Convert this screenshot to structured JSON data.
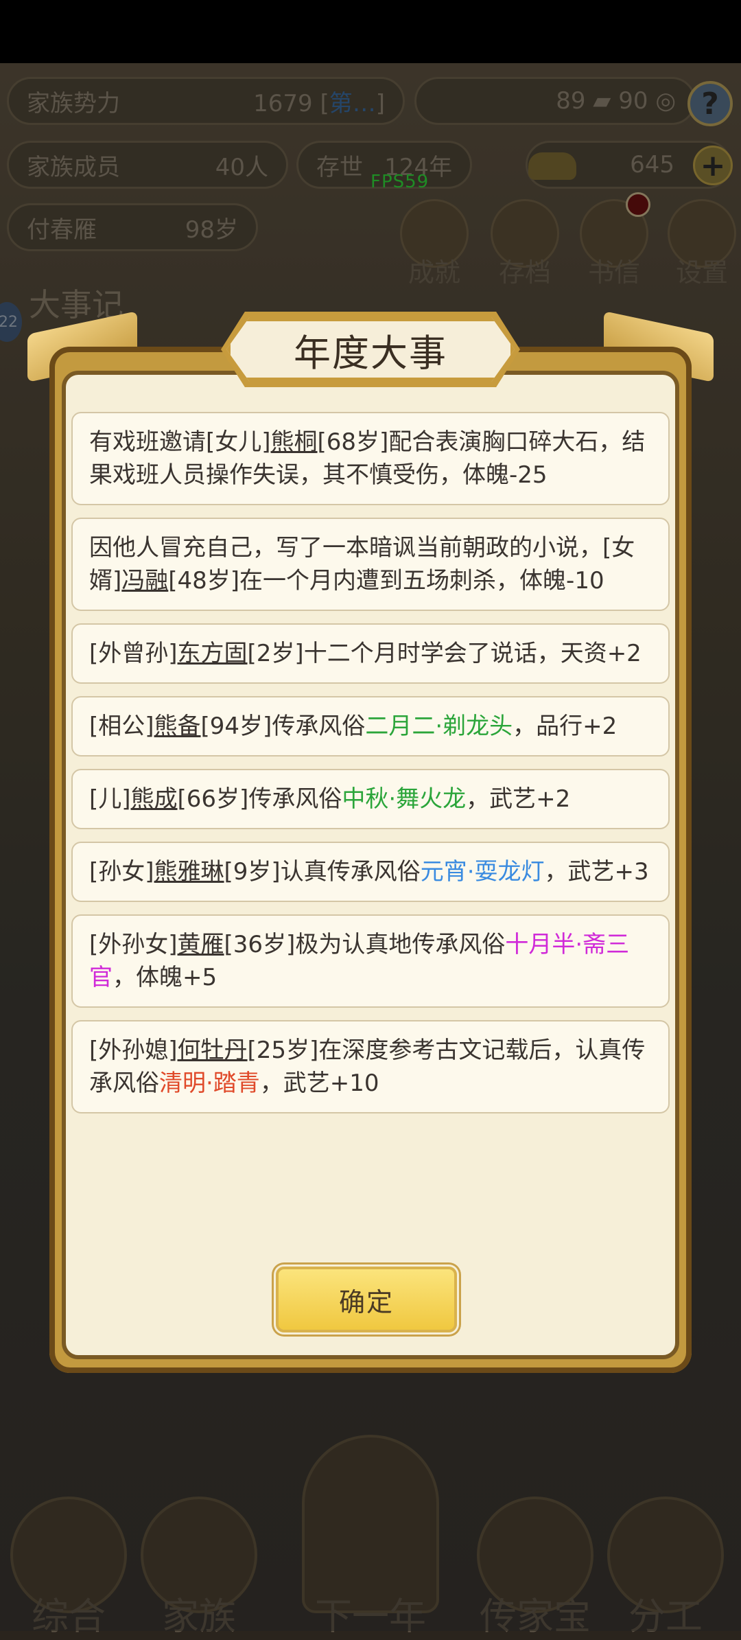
{
  "status_bar": {},
  "header": {
    "family_power_label": "家族势力",
    "family_power_value": "1679 [",
    "family_power_rank": "第…",
    "family_power_close": "]",
    "coins_value": "89",
    "coins_max": "90",
    "members_label": "家族成员",
    "members_value": "40人",
    "existence_label": "存世",
    "existence_value": "124年",
    "gold_value": "645",
    "patriarch_name": "付春雁",
    "patriarch_age": "98岁"
  },
  "fps": "FPS59",
  "top_buttons": [
    {
      "label": "成就",
      "icon": "achievement-icon"
    },
    {
      "label": "存档",
      "icon": "save-icon"
    },
    {
      "label": "书信",
      "icon": "letter-icon"
    },
    {
      "label": "设置",
      "icon": "settings-icon"
    }
  ],
  "background_title": "大事记",
  "day_badge": "22",
  "modal": {
    "title": "年度大事",
    "confirm_label": "确定",
    "events": [
      {
        "parts": [
          {
            "t": "有戏班邀请[女儿]"
          },
          {
            "t": "熊桐",
            "u": true
          },
          {
            "t": "[68岁]配合表演胸口碎大石，结果戏班人员操作失误，其不慎受伤，体魄-25"
          }
        ]
      },
      {
        "parts": [
          {
            "t": "因他人冒充自己，写了一本暗讽当前朝政的小说，[女婿]"
          },
          {
            "t": "冯融",
            "u": true
          },
          {
            "t": "[48岁]在一个月内遭到五场刺杀，体魄-10"
          }
        ]
      },
      {
        "parts": [
          {
            "t": "[外曾孙]"
          },
          {
            "t": "东方固",
            "u": true
          },
          {
            "t": "[2岁]十二个月时学会了说话，天资+2"
          }
        ]
      },
      {
        "parts": [
          {
            "t": "[相公]"
          },
          {
            "t": "熊备",
            "u": true
          },
          {
            "t": "[94岁]传承风俗"
          },
          {
            "t": "二月二·剃龙头",
            "c": "green"
          },
          {
            "t": "，品行+2"
          }
        ]
      },
      {
        "parts": [
          {
            "t": "[儿]"
          },
          {
            "t": "熊成",
            "u": true
          },
          {
            "t": "[66岁]传承风俗"
          },
          {
            "t": "中秋·舞火龙",
            "c": "green"
          },
          {
            "t": "，武艺+2"
          }
        ]
      },
      {
        "parts": [
          {
            "t": "[孙女]"
          },
          {
            "t": "熊雅琳",
            "u": true
          },
          {
            "t": "[9岁]认真传承风俗"
          },
          {
            "t": "元宵·耍龙灯",
            "c": "blue"
          },
          {
            "t": "，武艺+3"
          }
        ]
      },
      {
        "parts": [
          {
            "t": "[外孙女]"
          },
          {
            "t": "黄雁",
            "u": true
          },
          {
            "t": "[36岁]极为认真地传承风俗"
          },
          {
            "t": "十月半·斋三官",
            "c": "magenta"
          },
          {
            "t": "，体魄+5"
          }
        ]
      },
      {
        "parts": [
          {
            "t": "[外孙媳]"
          },
          {
            "t": "何牡丹",
            "u": true
          },
          {
            "t": "[25岁]在深度参考古文记载后，认真传承风俗"
          },
          {
            "t": "清明·踏青",
            "c": "red"
          },
          {
            "t": "，武艺+10"
          }
        ]
      }
    ]
  },
  "bottom_nav": [
    {
      "label": "综合"
    },
    {
      "label": "家族"
    },
    {
      "label": "下一年"
    },
    {
      "label": "传家宝"
    },
    {
      "label": "分工"
    }
  ],
  "colors": {
    "green": "#2ba53a",
    "blue": "#3a8be0",
    "magenta": "#d02ad8",
    "red": "#e04a2a",
    "fps": "#30d83a"
  }
}
